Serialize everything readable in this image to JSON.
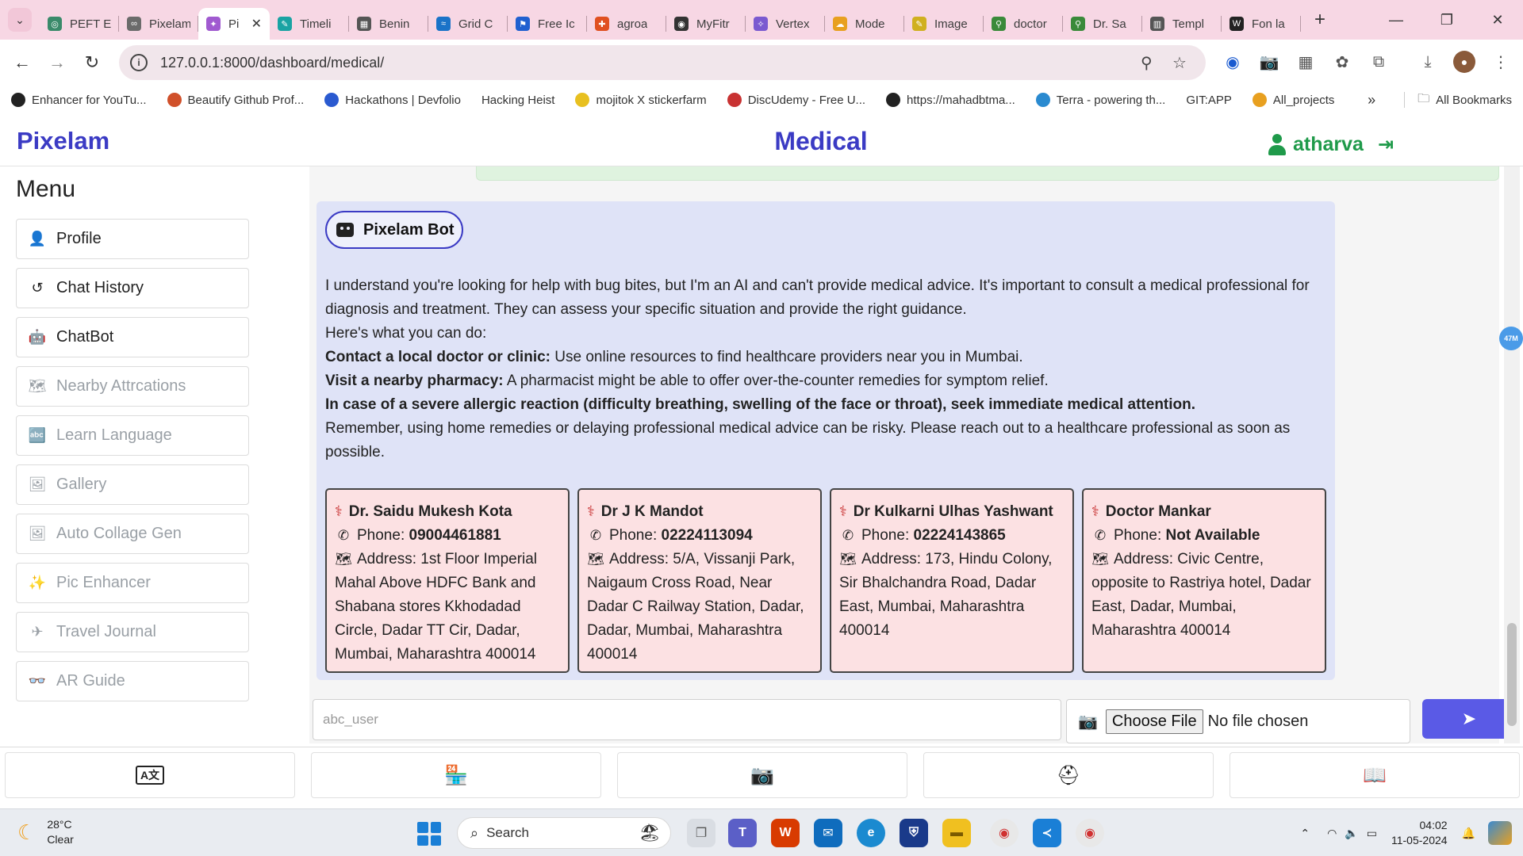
{
  "browser": {
    "tabs": [
      {
        "title": "PEFT E",
        "color": "#3a8a6a",
        "glyph": "◎"
      },
      {
        "title": "Pixelam",
        "color": "#6b6b6b",
        "glyph": "∞"
      },
      {
        "title": "Pi",
        "color": "#a05ad0",
        "glyph": "✦",
        "active": true
      },
      {
        "title": "Timeli",
        "color": "#1aa3a3",
        "glyph": "✎"
      },
      {
        "title": "Benin",
        "color": "#555555",
        "glyph": "▦"
      },
      {
        "title": "Grid C",
        "color": "#1a73c8",
        "glyph": "≈"
      },
      {
        "title": "Free Ic",
        "color": "#2060d0",
        "glyph": "⚑"
      },
      {
        "title": "agroa",
        "color": "#e05020",
        "glyph": "✚"
      },
      {
        "title": "MyFitr",
        "color": "#333333",
        "glyph": "◉"
      },
      {
        "title": "Vertex",
        "color": "#7a5ad0",
        "glyph": "✧"
      },
      {
        "title": "Mode",
        "color": "#e8a020",
        "glyph": "☁"
      },
      {
        "title": "Image",
        "color": "#d0b020",
        "glyph": "✎"
      },
      {
        "title": "doctor",
        "color": "#3a8a3a",
        "glyph": "⚲"
      },
      {
        "title": "Dr. Sa",
        "color": "#3a8a3a",
        "glyph": "⚲"
      },
      {
        "title": "Templ",
        "color": "#555555",
        "glyph": "▥"
      },
      {
        "title": "Fon la",
        "color": "#222222",
        "glyph": "W"
      }
    ],
    "url": "127.0.0.1:8000/dashboard/medical/",
    "bookmarks": [
      {
        "label": "Enhancer for YouTu...",
        "color": "#222"
      },
      {
        "label": "Beautify Github Prof...",
        "color": "#d0502a"
      },
      {
        "label": "Hackathons | Devfolio",
        "color": "#2a5ad0"
      },
      {
        "label": "Hacking Heist",
        "color": ""
      },
      {
        "label": "mojitok X stickerfarm",
        "color": "#e8c020"
      },
      {
        "label": "DiscUdemy - Free U...",
        "color": "#c83232"
      },
      {
        "label": "https://mahadbtma...",
        "color": "#222"
      },
      {
        "label": "Terra - powering th...",
        "color": "#2a8ad0"
      },
      {
        "label": "GIT:APP",
        "color": ""
      },
      {
        "label": "All_projects",
        "color": "#e8a020"
      }
    ],
    "all_bookmarks": "All Bookmarks"
  },
  "app": {
    "brand": "Pixelam",
    "page_title": "Medical",
    "username": "atharva",
    "menu_title": "Menu",
    "menu": [
      {
        "label": "Profile",
        "icon": "👤",
        "enabled": true
      },
      {
        "label": "Chat History",
        "icon": "↺",
        "enabled": true
      },
      {
        "label": "ChatBot",
        "icon": "🤖",
        "enabled": true
      },
      {
        "label": "Nearby Attrcations",
        "icon": "🗺",
        "enabled": false
      },
      {
        "label": "Learn Language",
        "icon": "🔤",
        "enabled": false
      },
      {
        "label": "Gallery",
        "icon": "🖼",
        "enabled": false
      },
      {
        "label": "Auto Collage Gen",
        "icon": "🖼",
        "enabled": false
      },
      {
        "label": "Pic Enhancer",
        "icon": "✨",
        "enabled": false
      },
      {
        "label": "Travel Journal",
        "icon": "✈",
        "enabled": false
      },
      {
        "label": "AR Guide",
        "icon": "👓",
        "enabled": false
      }
    ]
  },
  "chat": {
    "bot_name": "Pixelam Bot",
    "intro": "I understand you're looking for help with bug bites, but I'm an AI and can't provide medical advice. It's important to consult a medical professional for diagnosis and treatment. They can assess your specific situation and provide the right guidance.",
    "here": "Here's what you can do:",
    "tips": [
      {
        "bold": "Contact a local doctor or clinic:",
        "text": " Use online resources to find healthcare providers near you in Mumbai."
      },
      {
        "bold": "Visit a nearby pharmacy:",
        "text": " A pharmacist might be able to offer over-the-counter remedies for symptom relief."
      },
      {
        "bold": "In case of a severe allergic reaction (difficulty breathing, swelling of the face or throat), seek immediate medical attention.",
        "text": ""
      }
    ],
    "closing": "Remember, using home remedies or delaying professional medical advice can be risky. Please reach out to a healthcare professional as soon as possible.",
    "phone_label": "Phone:",
    "address_label": "Address:",
    "doctors": [
      {
        "name": "Dr. Saidu Mukesh Kota",
        "phone": "09004461881",
        "address": "1st Floor Imperial Mahal Above HDFC Bank and Shabana stores Kkhodadad Circle, Dadar TT Cir, Dadar, Mumbai, Maharashtra 400014"
      },
      {
        "name": "Dr J K Mandot",
        "phone": "02224113094",
        "address": "5/A, Vissanji Park, Naigaum Cross Road, Near Dadar C Railway Station, Dadar, Dadar, Mumbai, Maharashtra 400014"
      },
      {
        "name": "Dr Kulkarni Ulhas Yashwant",
        "phone": "02224143865",
        "address": "173, Hindu Colony, Sir Bhalchandra Road, Dadar East, Mumbai, Maharashtra 400014"
      },
      {
        "name": "Doctor Mankar",
        "phone": "Not Available",
        "address": "Civic Centre, opposite to Rastriya hotel, Dadar East, Dadar, Mumbai, Maharashtra 400014"
      }
    ],
    "input_placeholder": "abc_user",
    "choose_file": "Choose File",
    "no_file": "No file chosen",
    "float_badge": "47M"
  },
  "bottom_nav": [
    "translate-icon",
    "store-icon",
    "camera-icon",
    "medical-kit-icon",
    "book-icon"
  ],
  "taskbar": {
    "temp": "28°C",
    "condition": "Clear",
    "search": "Search",
    "time": "04:02",
    "date": "11-05-2024"
  }
}
